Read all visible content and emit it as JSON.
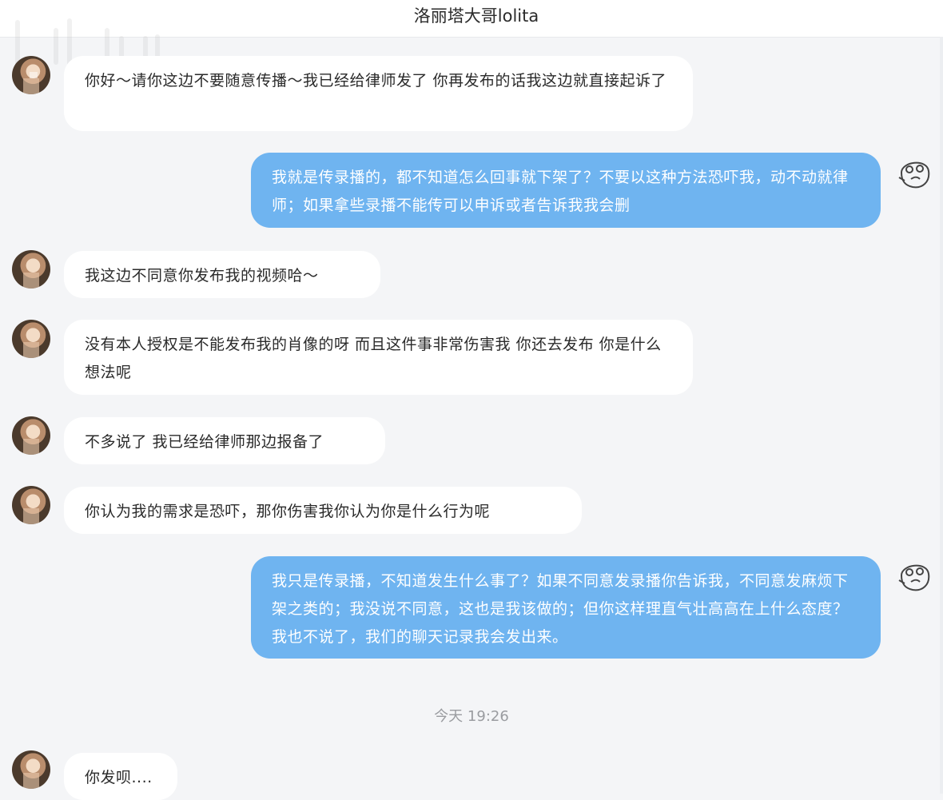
{
  "header": {
    "title": "洛丽塔大哥lolita"
  },
  "messages": [
    {
      "side": "left",
      "text": "你好～请你这边不要随意传播～我已经给律师发了 你再发布的话我这边就直接起诉了"
    },
    {
      "side": "right",
      "text": "我就是传录播的，都不知道怎么回事就下架了？不要以这种方法恐吓我，动不动就律师；如果拿些录播不能传可以申诉或者告诉我我会删"
    },
    {
      "side": "left",
      "text": "我这边不同意你发布我的视频哈～"
    },
    {
      "side": "left",
      "text": "没有本人授权是不能发布我的肖像的呀 而且这件事非常伤害我 你还去发布 你是什么想法呢"
    },
    {
      "side": "left",
      "text": "不多说了 我已经给律师那边报备了"
    },
    {
      "side": "left",
      "text": "你认为我的需求是恐吓，那你伤害我你认为你是什么行为呢"
    },
    {
      "side": "right",
      "text": "我只是传录播，不知道发生什么事了？如果不同意发录播你告诉我，不同意发麻烦下架之类的；我没说不同意，这也是我该做的；但你这样理直气壮高高在上什么态度？我也不说了，我们的聊天记录我会发出来。"
    },
    {
      "side": "left",
      "text": "你发呗...."
    }
  ],
  "timestamp": "今天 19:26",
  "icons": {
    "contact_avatar": "contact-avatar-photo",
    "self_avatar": "meme-face-avatar",
    "watermark": "bilibili-watermark-icon"
  },
  "colors": {
    "sent_bubble": "#6fb4f0",
    "received_bubble": "#ffffff",
    "background": "#f4f5f7"
  }
}
